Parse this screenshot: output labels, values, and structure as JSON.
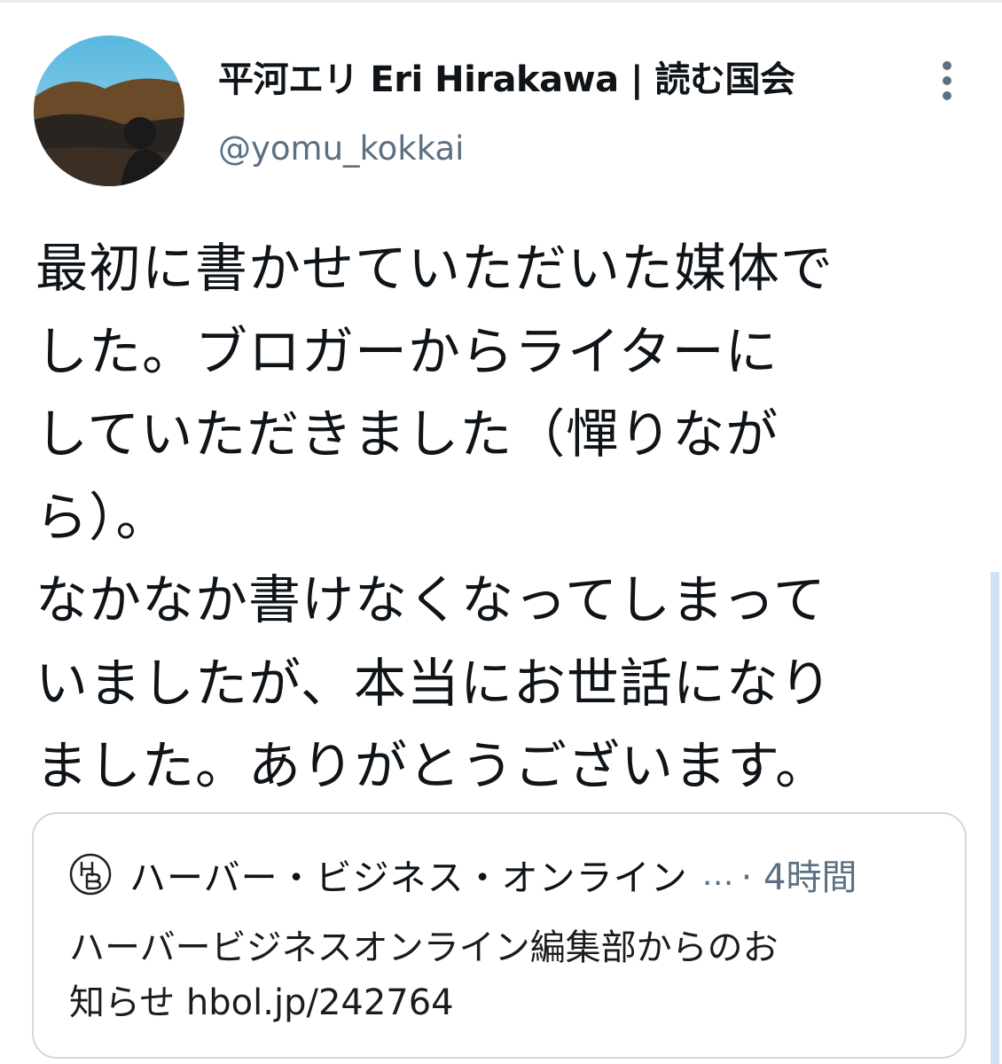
{
  "tweet": {
    "display_name": "平河エリ Eri Hirakawa | 読む国会",
    "handle": "@yomu_kokkai",
    "text_lines": [
      "最初に書かせていただいた媒体で",
      "した。ブロガーからライターに",
      "していただきました（憚りなが",
      "ら）。",
      "なかなか書けなくなってしまって",
      "いましたが、本当にお世話になり",
      "ました。ありがとうございます。"
    ]
  },
  "card": {
    "source_name": "ハーバー・ビジネス・オンライン",
    "ellipsis": "…",
    "time_prefix": "· ",
    "time": "4時間",
    "body_line1": "ハーバービジネスオンライン編集部からのお",
    "body_line2": "知らせ hbol.jp/242764"
  },
  "icons": {
    "more": "more-vertical-icon",
    "source_logo": "hbol-logo-icon"
  },
  "colors": {
    "secondary_text": "#5b7083",
    "border": "#cfd9de"
  }
}
